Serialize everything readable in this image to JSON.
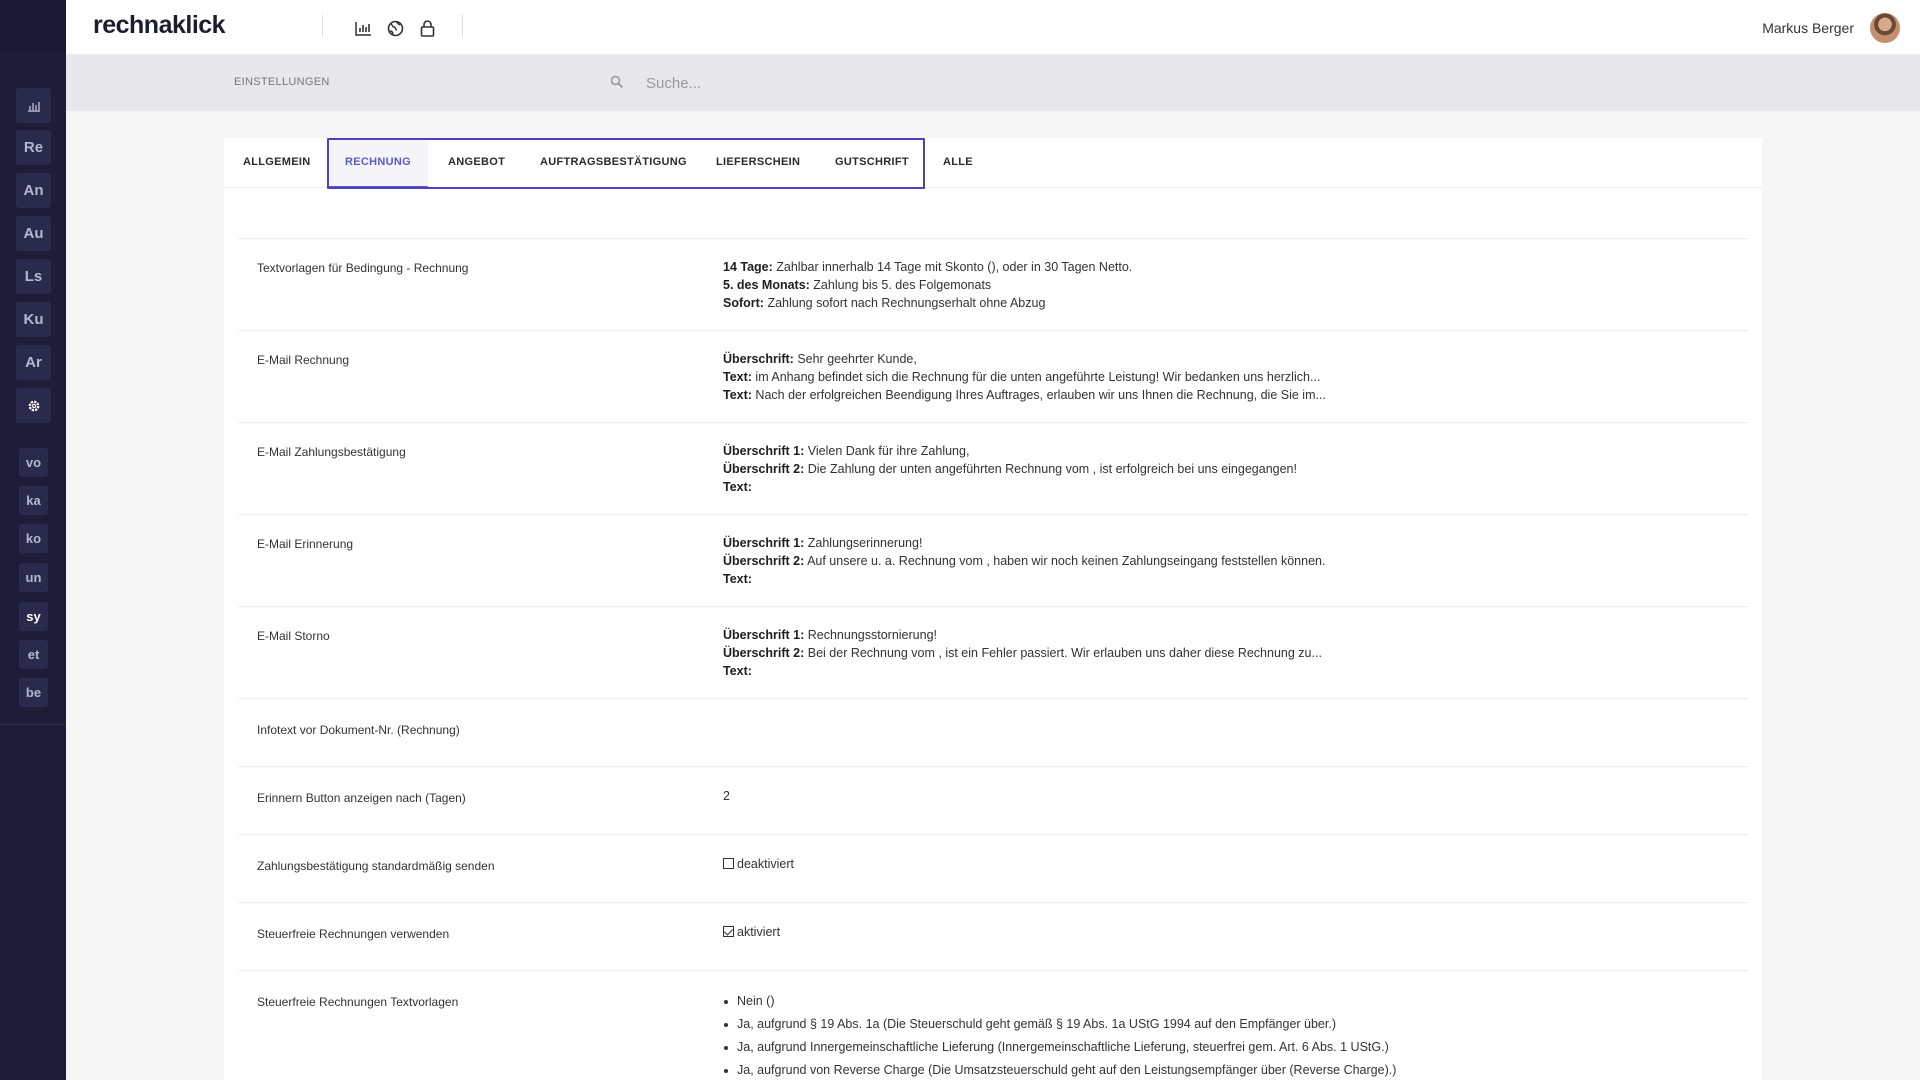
{
  "app": {
    "logo": "rechnaklick"
  },
  "header": {
    "user_name": "Markus Berger",
    "icons": [
      "chart-icon",
      "globe-icon",
      "lock-icon"
    ]
  },
  "sidebar": {
    "items": [
      "Re",
      "An",
      "Au",
      "Ls",
      "Ku",
      "Ar"
    ],
    "secondary": [
      "vo",
      "ka",
      "ko",
      "un",
      "sy",
      "et",
      "be"
    ]
  },
  "subheader": {
    "breadcrumb": "EINSTELLUNGEN",
    "search_placeholder": "Suche..."
  },
  "tabs": [
    "ALLGEMEIN",
    "RECHNUNG",
    "ANGEBOT",
    "AUFTRAGSBESTÄTIGUNG",
    "LIEFERSCHEIN",
    "GUTSCHRIFT",
    "ALLE"
  ],
  "active_tab": "RECHNUNG",
  "settings": {
    "textvorlagen": {
      "label": "Textvorlagen für Bedingung - Rechnung",
      "lines": [
        {
          "key": "14 Tage:",
          "text": " Zahlbar innerhalb 14 Tage mit Skonto (), oder in 30 Tagen Netto."
        },
        {
          "key": "5. des Monats:",
          "text": " Zahlung bis 5. des Folgemonats"
        },
        {
          "key": "Sofort:",
          "text": " Zahlung sofort nach Rechnungserhalt ohne Abzug"
        }
      ]
    },
    "email_rechnung": {
      "label": "E-Mail Rechnung",
      "lines": [
        {
          "key": "Überschrift:",
          "text": " Sehr geehrter Kunde,"
        },
        {
          "key": "Text:",
          "text": " im Anhang befindet sich die Rechnung für die unten angeführte Leistung! Wir bedanken uns herzlich..."
        },
        {
          "key": "Text:",
          "text": " Nach der erfolgreichen Beendigung Ihres Auftrages, erlauben wir uns Ihnen die Rechnung, die Sie im..."
        }
      ]
    },
    "email_zahlung": {
      "label": "E-Mail Zahlungsbestätigung",
      "lines": [
        {
          "key": "Überschrift 1:",
          "text": " Vielen Dank für ihre Zahlung,"
        },
        {
          "key": "Überschrift 2:",
          "text": " Die Zahlung der unten angeführten Rechnung vom , ist erfolgreich bei uns eingegangen!"
        },
        {
          "key": "Text:",
          "text": ""
        }
      ]
    },
    "email_erinnerung": {
      "label": "E-Mail Erinnerung",
      "lines": [
        {
          "key": "Überschrift 1:",
          "text": " Zahlungserinnerung!"
        },
        {
          "key": "Überschrift 2:",
          "text": " Auf unsere u. a. Rechnung vom , haben wir noch keinen Zahlungseingang feststellen können."
        },
        {
          "key": "Text:",
          "text": ""
        }
      ]
    },
    "email_storno": {
      "label": "E-Mail Storno",
      "lines": [
        {
          "key": "Überschrift 1:",
          "text": " Rechnungsstornierung!"
        },
        {
          "key": "Überschrift 2:",
          "text": " Bei der Rechnung vom , ist ein Fehler passiert. Wir erlauben uns daher diese Rechnung zu..."
        },
        {
          "key": "Text:",
          "text": ""
        }
      ]
    },
    "infotext": {
      "label": "Infotext vor Dokument-Nr. (Rechnung)",
      "value": ""
    },
    "erinnern": {
      "label": "Erinnern Button anzeigen nach (Tagen)",
      "value": "2"
    },
    "zahlungsbestaetigung_senden": {
      "label": "Zahlungsbestätigung standardmäßig senden",
      "checked": false,
      "value": "deaktiviert"
    },
    "steuerfrei": {
      "label": "Steuerfreie Rechnungen verwenden",
      "checked": true,
      "value": "aktiviert"
    },
    "steuerfrei_vorlagen": {
      "label": "Steuerfreie Rechnungen Textvorlagen",
      "items": [
        "Nein ()",
        "Ja, aufgrund § 19 Abs. 1a (Die Steuerschuld geht gemäß § 19 Abs. 1a UStG 1994 auf den Empfänger über.)",
        "Ja, aufgrund Innergemeinschaftliche Lieferung (Innergemeinschaftliche Lieferung, steuerfrei gem. Art. 6 Abs. 1 UStG.)",
        "Ja, aufgrund von Reverse Charge (Die Umsatzsteuerschuld geht auf den Leistungsempfänger über (Reverse Charge).)"
      ]
    }
  }
}
